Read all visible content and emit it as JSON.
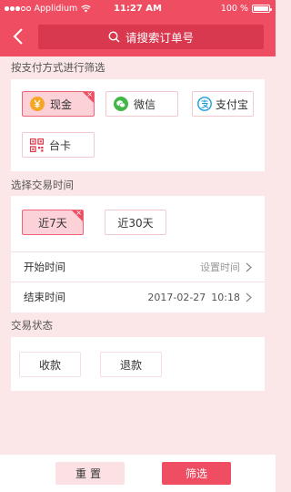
{
  "statusbar": {
    "carrier": "Applidium",
    "time": "11:27 AM",
    "battery": "100 %"
  },
  "header": {
    "search_placeholder": "请搜索订单号"
  },
  "payment": {
    "title": "按支付方式进行筛选",
    "options": [
      {
        "label": "现金",
        "icon": "yen-coin-icon",
        "selected": true
      },
      {
        "label": "微信",
        "icon": "wechat-icon",
        "selected": false
      },
      {
        "label": "支付宝",
        "icon": "alipay-icon",
        "selected": false
      },
      {
        "label": "台卡",
        "icon": "qr-code-icon",
        "selected": false
      }
    ]
  },
  "time": {
    "title": "选择交易时间",
    "ranges": [
      {
        "label": "近7天",
        "selected": true
      },
      {
        "label": "近30天",
        "selected": false
      }
    ],
    "start_label": "开始时间",
    "start_value": "设置时间",
    "end_label": "结束时间",
    "end_date": "2017-02-27",
    "end_time": "10:18"
  },
  "status": {
    "title": "交易状态",
    "options": [
      {
        "label": "收款",
        "selected": false
      },
      {
        "label": "退款",
        "selected": false
      }
    ]
  },
  "footer": {
    "reset_label": "重置",
    "filter_label": "筛选"
  },
  "colors": {
    "accent": "#ee4d62",
    "background": "#fbe7e8"
  }
}
